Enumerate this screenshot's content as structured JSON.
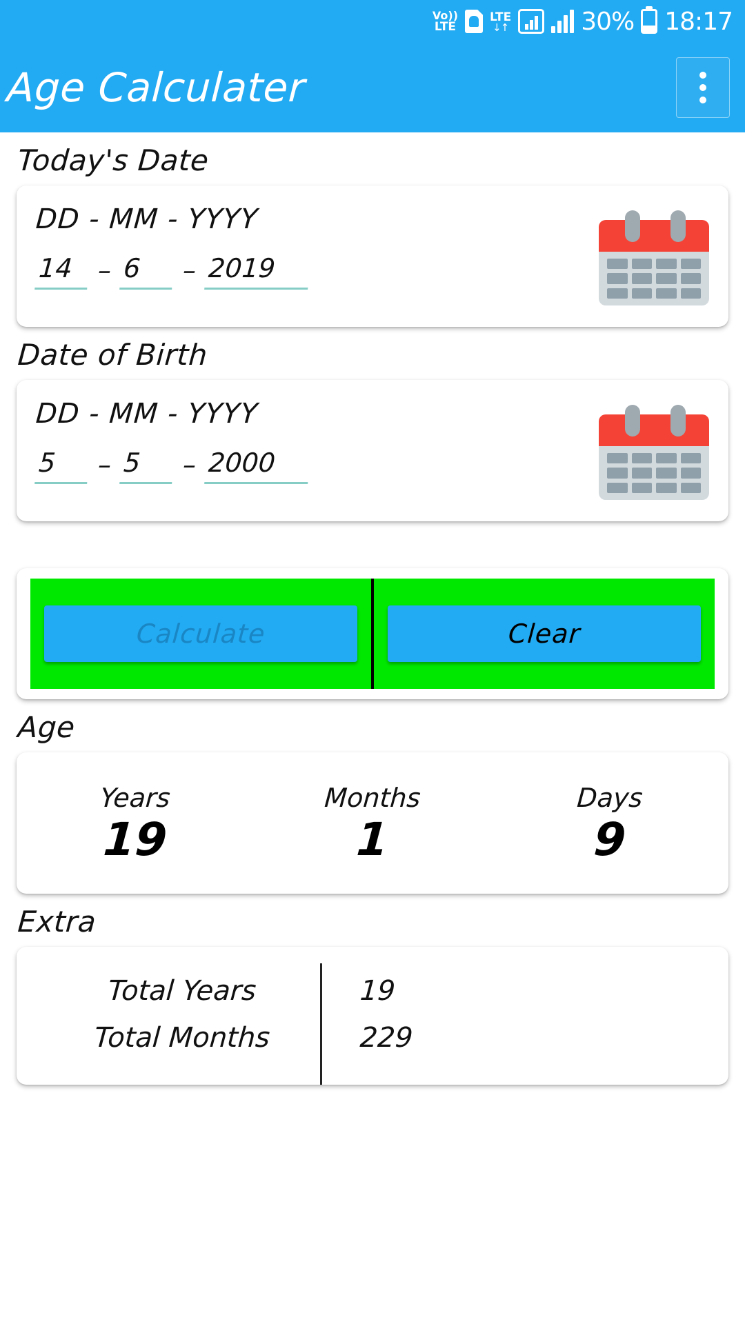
{
  "status_bar": {
    "volte_line1": "Vo))",
    "volte_line2": "LTE",
    "sim_icon": "sim-card-icon",
    "lte_label": "LTE",
    "lte_arrows": "↓↑",
    "battery_percent": "30%",
    "time": "18:17"
  },
  "app_bar": {
    "title": "Age Calculater",
    "overflow_menu": "overflow-menu-icon"
  },
  "todays_date": {
    "section_label": "Today's Date",
    "format_label": "DD - MM - YYYY",
    "day": "14",
    "month": "6",
    "year": "2019",
    "separator": "–",
    "calendar_icon": "calendar-icon"
  },
  "date_of_birth": {
    "section_label": "Date of Birth",
    "format_label": "DD - MM - YYYY",
    "day": "5",
    "month": "5",
    "year": "2000",
    "separator": "–",
    "calendar_icon": "calendar-icon"
  },
  "actions": {
    "calculate_label": "Calculate",
    "clear_label": "Clear"
  },
  "age": {
    "section_label": "Age",
    "columns": [
      {
        "label": "Years",
        "value": "19"
      },
      {
        "label": "Months",
        "value": "1"
      },
      {
        "label": "Days",
        "value": "9"
      }
    ]
  },
  "extra": {
    "section_label": "Extra",
    "rows": [
      {
        "key": "Total Years",
        "value": "19"
      },
      {
        "key": "Total Months",
        "value": "229"
      }
    ]
  },
  "colors": {
    "accent_blue": "#22AAF2",
    "button_green": "#00e800",
    "underline_teal": "#86cdc6",
    "calendar_red": "#f44336",
    "calendar_gray": "#d3dade"
  }
}
